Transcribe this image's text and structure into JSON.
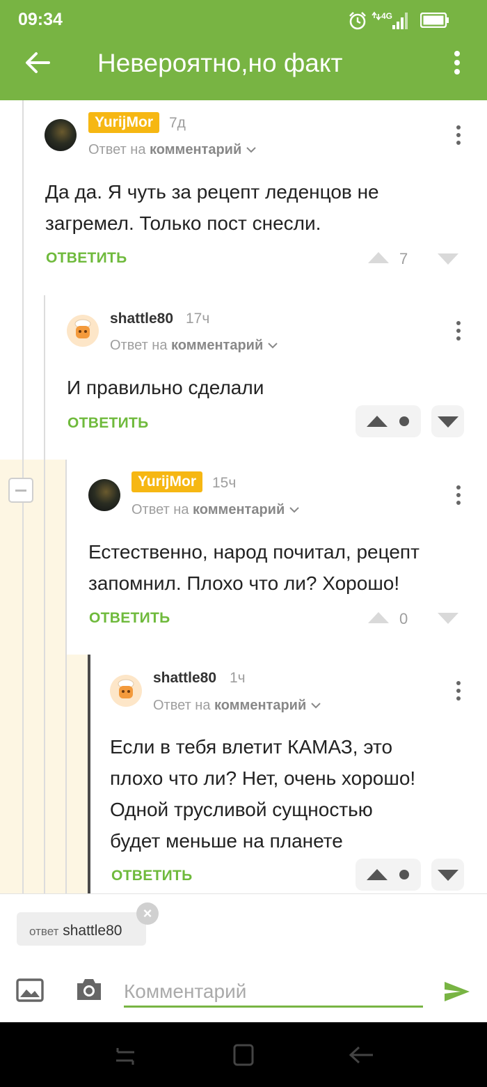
{
  "status_bar": {
    "time": "09:34",
    "network": "4G"
  },
  "app_bar": {
    "title": "Невероятно,но факт",
    "back_icon": "arrow-left-icon",
    "menu_icon": "more-vertical-icon"
  },
  "comments": [
    {
      "username": "YurijMor",
      "age": "7д",
      "reply_prefix": "Ответ на",
      "reply_target": "комментарий",
      "text_lines": [
        "Да да. Я чуть за рецепт леденцов не",
        "загремел. Только пост снесли."
      ],
      "answer_label": "ОТВЕТИТЬ",
      "rating": "7"
    },
    {
      "username": "shattle80",
      "age": "17ч",
      "reply_prefix": "Ответ на",
      "reply_target": "комментарий",
      "text_lines": [
        "И правильно сделали"
      ],
      "answer_label": "ОТВЕТИТЬ"
    },
    {
      "username": "YurijMor",
      "age": "15ч",
      "reply_prefix": "Ответ на",
      "reply_target": "комментарий",
      "text_lines": [
        "Естественно, народ почитал, рецепт",
        "запомнил. Плохо что ли? Хорошо!"
      ],
      "answer_label": "ОТВЕТИТЬ",
      "rating": "0"
    },
    {
      "username": "shattle80",
      "age": "1ч",
      "reply_prefix": "Ответ на",
      "reply_target": "комментарий",
      "text_lines": [
        "Если в тебя влетит КАМАЗ, это",
        "плохо что ли? Нет, очень хорошо!",
        "Одной трусливой сущностью",
        "будет меньше на планете"
      ],
      "answer_label": "ОТВЕТИТЬ"
    }
  ],
  "reply_chip": {
    "prefix": "ответ",
    "user": "shattle80"
  },
  "composer": {
    "placeholder": "Комментарий",
    "send_icon": "send-icon",
    "gallery_icon": "image-icon",
    "camera_icon": "camera-icon"
  },
  "colors": {
    "brand_green": "#78b443",
    "badge_orange": "#f6b713",
    "highlight": "#fdf6e3"
  }
}
